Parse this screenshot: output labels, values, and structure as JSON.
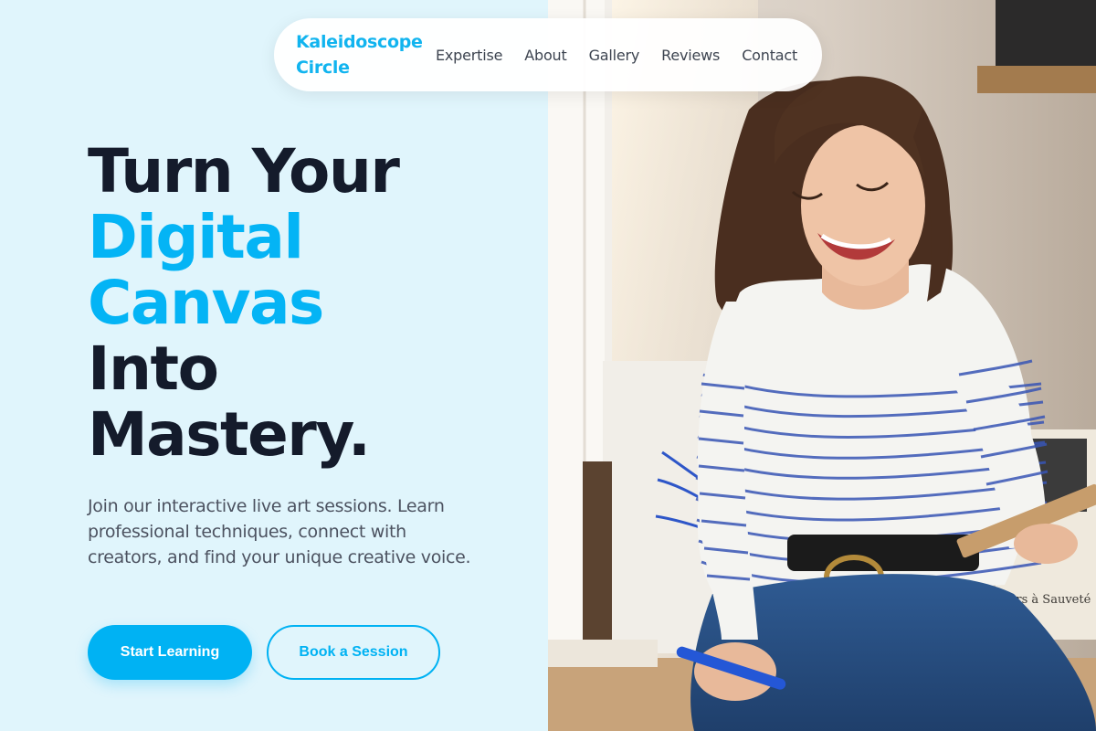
{
  "brand": {
    "line1": "Kaleidoscope",
    "line2": "Circle",
    "color": "#11b4ef"
  },
  "nav": {
    "items": [
      "Expertise",
      "About",
      "Gallery",
      "Reviews",
      "Contact"
    ]
  },
  "hero": {
    "title_line1": "Turn Your",
    "title_line2": "Digital",
    "title_line3": "Canvas",
    "title_line4": "Into",
    "title_line5": "Mastery.",
    "subtitle": "Join our interactive live art sessions. Learn professional techniques, connect with creators, and find your unique creative voice.",
    "primary_cta": "Start Learning",
    "secondary_cta": "Book a Session"
  },
  "photo": {
    "sign_text": "...rs à Sauveté"
  },
  "colors": {
    "accent": "#04b4f5",
    "heading": "#141b2b",
    "background": "#e0f5fc"
  }
}
